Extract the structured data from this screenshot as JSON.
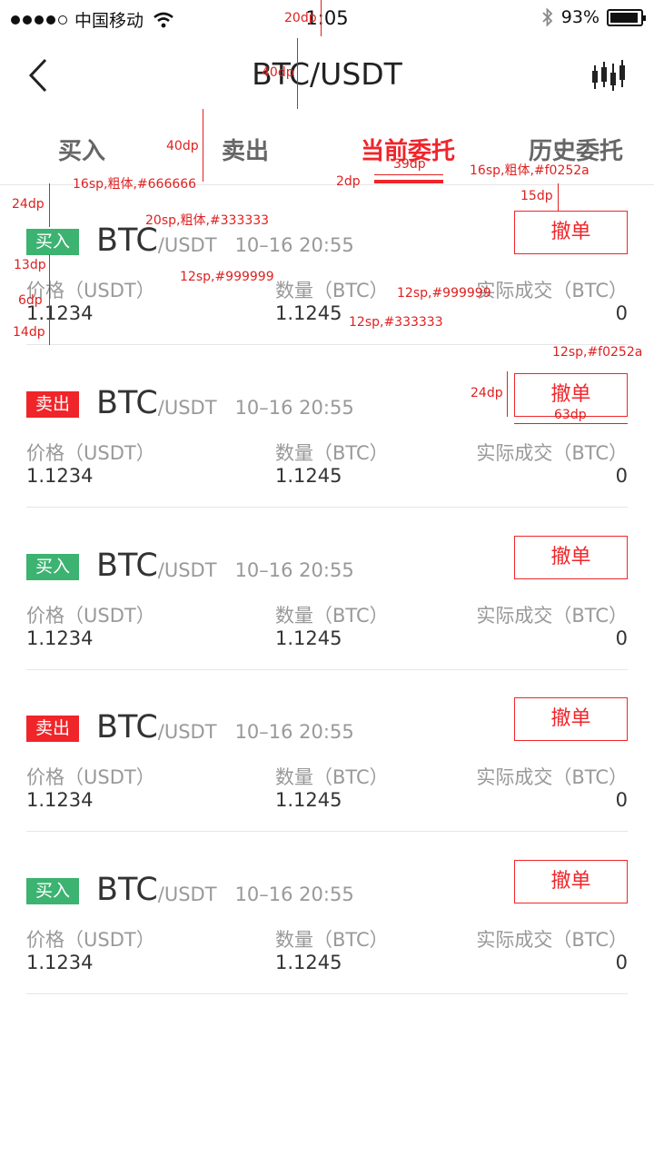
{
  "status_bar": {
    "carrier": "中国移动",
    "time": "1:05",
    "battery_percent": "93%",
    "battery_level": 0.93
  },
  "nav": {
    "title": "BTC/USDT",
    "back_icon": "chevron-left-icon",
    "chart_icon": "candlestick-chart-icon"
  },
  "tabs": [
    {
      "label": "买入",
      "active": false
    },
    {
      "label": "卖出",
      "active": false
    },
    {
      "label": "当前委托",
      "active": true
    },
    {
      "label": "历史委托",
      "active": false
    }
  ],
  "colors": {
    "accent": "#f0252a",
    "buy": "#3cb371",
    "sell": "#f0252a",
    "text_primary": "#333333",
    "text_secondary": "#999999",
    "tab_inactive": "#666666"
  },
  "column_labels": {
    "price": "价格（USDT）",
    "amount": "数量（BTC）",
    "filled": "实际成交（BTC）"
  },
  "cancel_label": "撤单",
  "orders": [
    {
      "side": "买入",
      "side_type": "buy",
      "base": "BTC",
      "quote": "/USDT",
      "time": "10–16 20:55",
      "price": "1.1234",
      "amount": "1.1245",
      "filled": "0"
    },
    {
      "side": "卖出",
      "side_type": "sell",
      "base": "BTC",
      "quote": "/USDT",
      "time": "10–16 20:55",
      "price": "1.1234",
      "amount": "1.1245",
      "filled": "0"
    },
    {
      "side": "买入",
      "side_type": "buy",
      "base": "BTC",
      "quote": "/USDT",
      "time": "10–16 20:55",
      "price": "1.1234",
      "amount": "1.1245",
      "filled": "0"
    },
    {
      "side": "卖出",
      "side_type": "sell",
      "base": "BTC",
      "quote": "/USDT",
      "time": "10–16 20:55",
      "price": "1.1234",
      "amount": "1.1245",
      "filled": "0"
    },
    {
      "side": "买入",
      "side_type": "buy",
      "base": "BTC",
      "quote": "/USDT",
      "time": "10–16 20:55",
      "price": "1.1234",
      "amount": "1.1245",
      "filled": "0"
    }
  ],
  "annotations": {
    "status_height": "20dp",
    "nav_height": "40dp",
    "tab_height": "40dp",
    "tab_inactive_spec": "16sp,粗体,#666666",
    "tab_active_spec": "16sp,粗体,#f0252a",
    "indicator_height": "2dp",
    "indicator_width": "39dp",
    "cancel_top_gap": "15dp",
    "item_top_gap": "24dp",
    "pair_spec": "20sp,粗体,#333333",
    "quote_spec": "12sp,#999999",
    "gap_13": "13dp",
    "gap_6": "6dp",
    "gap_14": "14dp",
    "label_spec": "12sp,#999999",
    "value_spec": "12sp,#333333",
    "cancel_spec": "12sp,#f0252a",
    "cancel_height": "24dp",
    "cancel_width": "63dp"
  }
}
